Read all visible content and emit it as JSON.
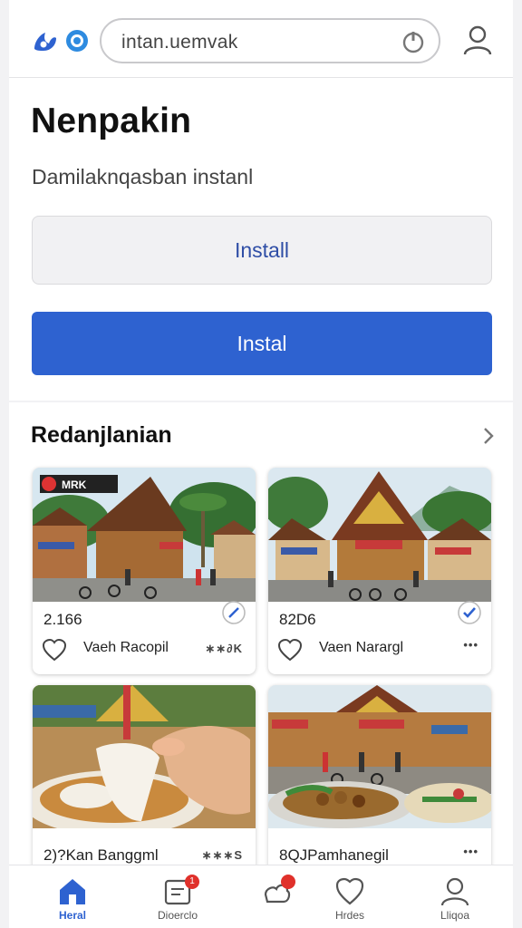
{
  "header": {
    "search": {
      "value": "intan.uemvak"
    },
    "icons": {
      "logo": "brand-logo-icon",
      "search_action": "power-icon",
      "profile": "user-icon"
    }
  },
  "main": {
    "title": "Nenpakin",
    "subtitle": "Damilaknqasban instanl",
    "secondary_button": "Install",
    "primary_button": "Instal",
    "accent_color": "#2e62d0"
  },
  "section": {
    "title": "Redanjlanian",
    "cards": [
      {
        "value": "2.166",
        "label": "Vaeh Racopil",
        "tail": "∗∗∂K",
        "sign_text": "MRK",
        "checked": false
      },
      {
        "value": "82D6",
        "label": "Vaen Narargl",
        "tail": "•••",
        "checked": true
      },
      {
        "value": "2)?Kan Banggml",
        "tail": "∗∗∗S"
      },
      {
        "value": "8QJPamhanegil",
        "tail": "•••"
      }
    ]
  },
  "nav": {
    "items": [
      {
        "label": "Heral",
        "icon": "home-icon",
        "active": true
      },
      {
        "label": "Dioerclo",
        "icon": "list-icon",
        "badge": "1"
      },
      {
        "label": "",
        "icon": "cloud-icon",
        "badge": ""
      },
      {
        "label": "Hrdes",
        "icon": "heart-icon"
      },
      {
        "label": "Lliqoa",
        "icon": "user-icon"
      }
    ]
  }
}
